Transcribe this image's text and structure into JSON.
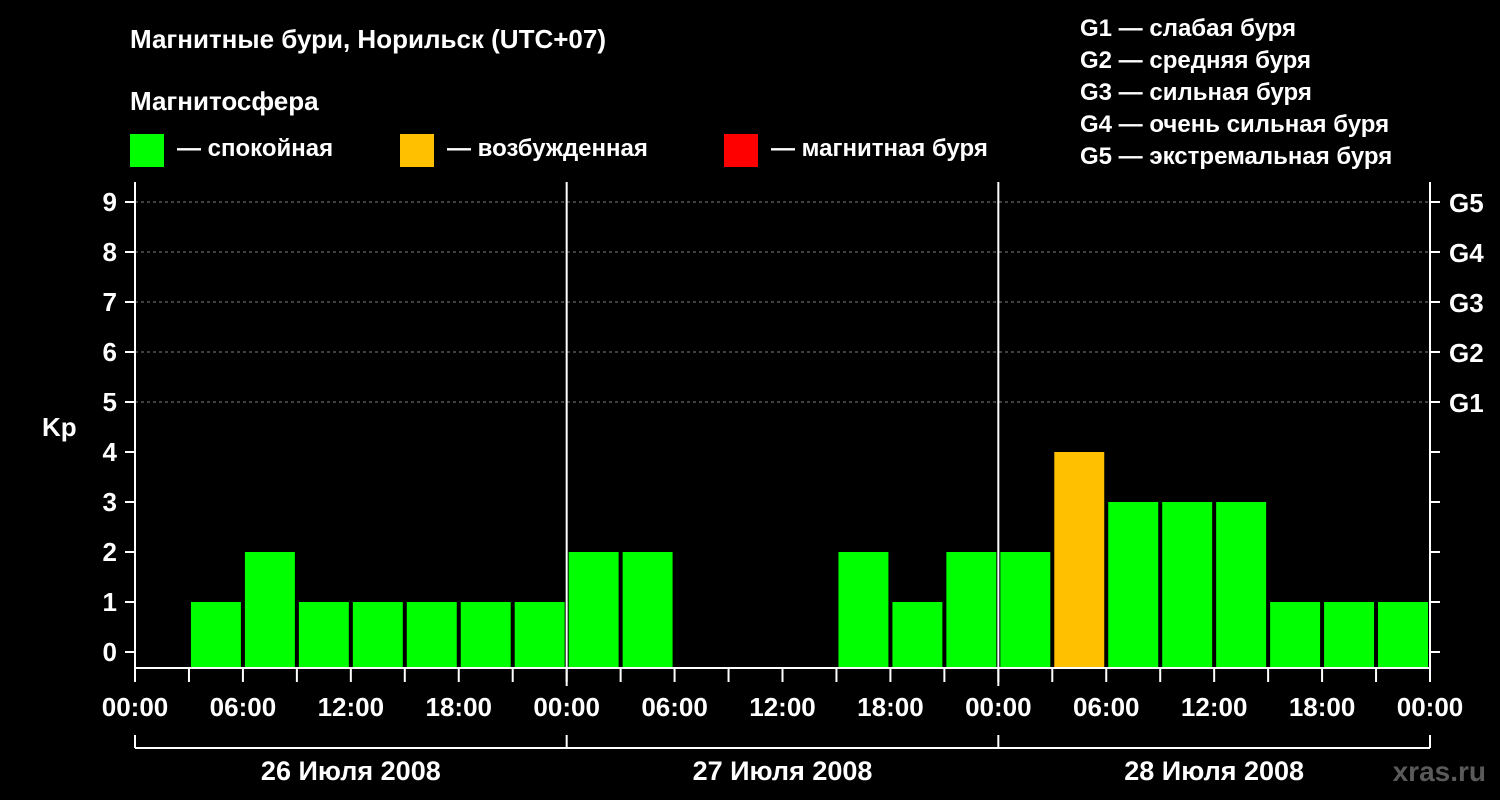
{
  "title": "Магнитные бури, Норильск (UTC+07)",
  "subtitle": "Магнитосфера",
  "legend": [
    {
      "label": "— спокойная",
      "color": "#00ff00"
    },
    {
      "label": "— возбужденная",
      "color": "#ffc000"
    },
    {
      "label": "— магнитная буря",
      "color": "#ff0000"
    }
  ],
  "g_legend": [
    "G1 — слабая буря",
    "G2 — средняя буря",
    "G3 — сильная буря",
    "G4 — очень сильная буря",
    "G5 — экстремальная буря"
  ],
  "watermark": "xras.ru",
  "chart_data": {
    "type": "bar",
    "ylabel": "Kp",
    "ylim": [
      0,
      9
    ],
    "y_ticks": [
      "0",
      "1",
      "2",
      "3",
      "4",
      "5",
      "6",
      "7",
      "8",
      "9"
    ],
    "g_ticks": [
      {
        "kp": 5,
        "label": "G1"
      },
      {
        "kp": 6,
        "label": "G2"
      },
      {
        "kp": 7,
        "label": "G3"
      },
      {
        "kp": 8,
        "label": "G4"
      },
      {
        "kp": 9,
        "label": "G5"
      }
    ],
    "grid": "dashed horizontal lines at Kp 5–9",
    "x_tick_labels": [
      "00:00",
      "06:00",
      "12:00",
      "18:00",
      "00:00",
      "06:00",
      "12:00",
      "18:00",
      "00:00",
      "06:00",
      "12:00",
      "18:00",
      "00:00"
    ],
    "days": [
      "26 Июля 2008",
      "27 Июля 2008",
      "28 Июля 2008"
    ],
    "interval_hours": 3,
    "series": [
      {
        "values": [
          null,
          1,
          2,
          1,
          1,
          1,
          1,
          1,
          2,
          2,
          null,
          null,
          null,
          2,
          1,
          2,
          2,
          4,
          3,
          3,
          3,
          1,
          1,
          1
        ],
        "colors": [
          "",
          "#00ff00",
          "#00ff00",
          "#00ff00",
          "#00ff00",
          "#00ff00",
          "#00ff00",
          "#00ff00",
          "#00ff00",
          "#00ff00",
          "",
          "",
          "",
          "#00ff00",
          "#00ff00",
          "#00ff00",
          "#00ff00",
          "#ffc000",
          "#00ff00",
          "#00ff00",
          "#00ff00",
          "#00ff00",
          "#00ff00",
          "#00ff00"
        ]
      }
    ]
  }
}
